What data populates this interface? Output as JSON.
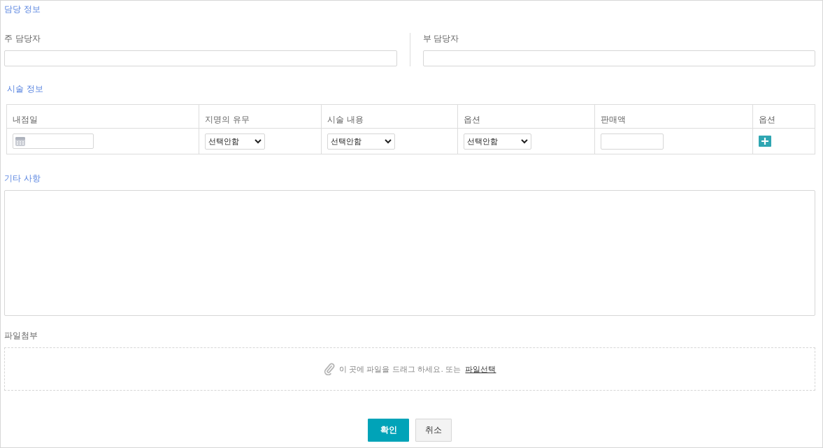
{
  "manager_section": {
    "title": "담당 정보",
    "fields": [
      {
        "label": "주 담당자"
      },
      {
        "label": "부 담당자"
      }
    ]
  },
  "procedure_section": {
    "title": "시술 정보",
    "columns": [
      "내점일",
      "지명의 유무",
      "시술 내용",
      "옵션",
      "판매액",
      "옵션"
    ],
    "row": [
      {
        "kind": "date"
      },
      {
        "kind": "select",
        "value": "선택안함"
      },
      {
        "kind": "select",
        "value": "선택안함"
      },
      {
        "kind": "select",
        "value": "선택안함"
      },
      {
        "kind": "input"
      },
      {
        "kind": "add"
      }
    ]
  },
  "notes_section": {
    "title": "기타 사항"
  },
  "attachment": {
    "label": "파일첨부",
    "hint": "이 곳에 파일을 드래그 하세요. 또는",
    "link": "파일선택"
  },
  "buttons": [
    {
      "label": "확인",
      "kind": "primary"
    },
    {
      "label": "취소",
      "kind": "secondary"
    }
  ]
}
